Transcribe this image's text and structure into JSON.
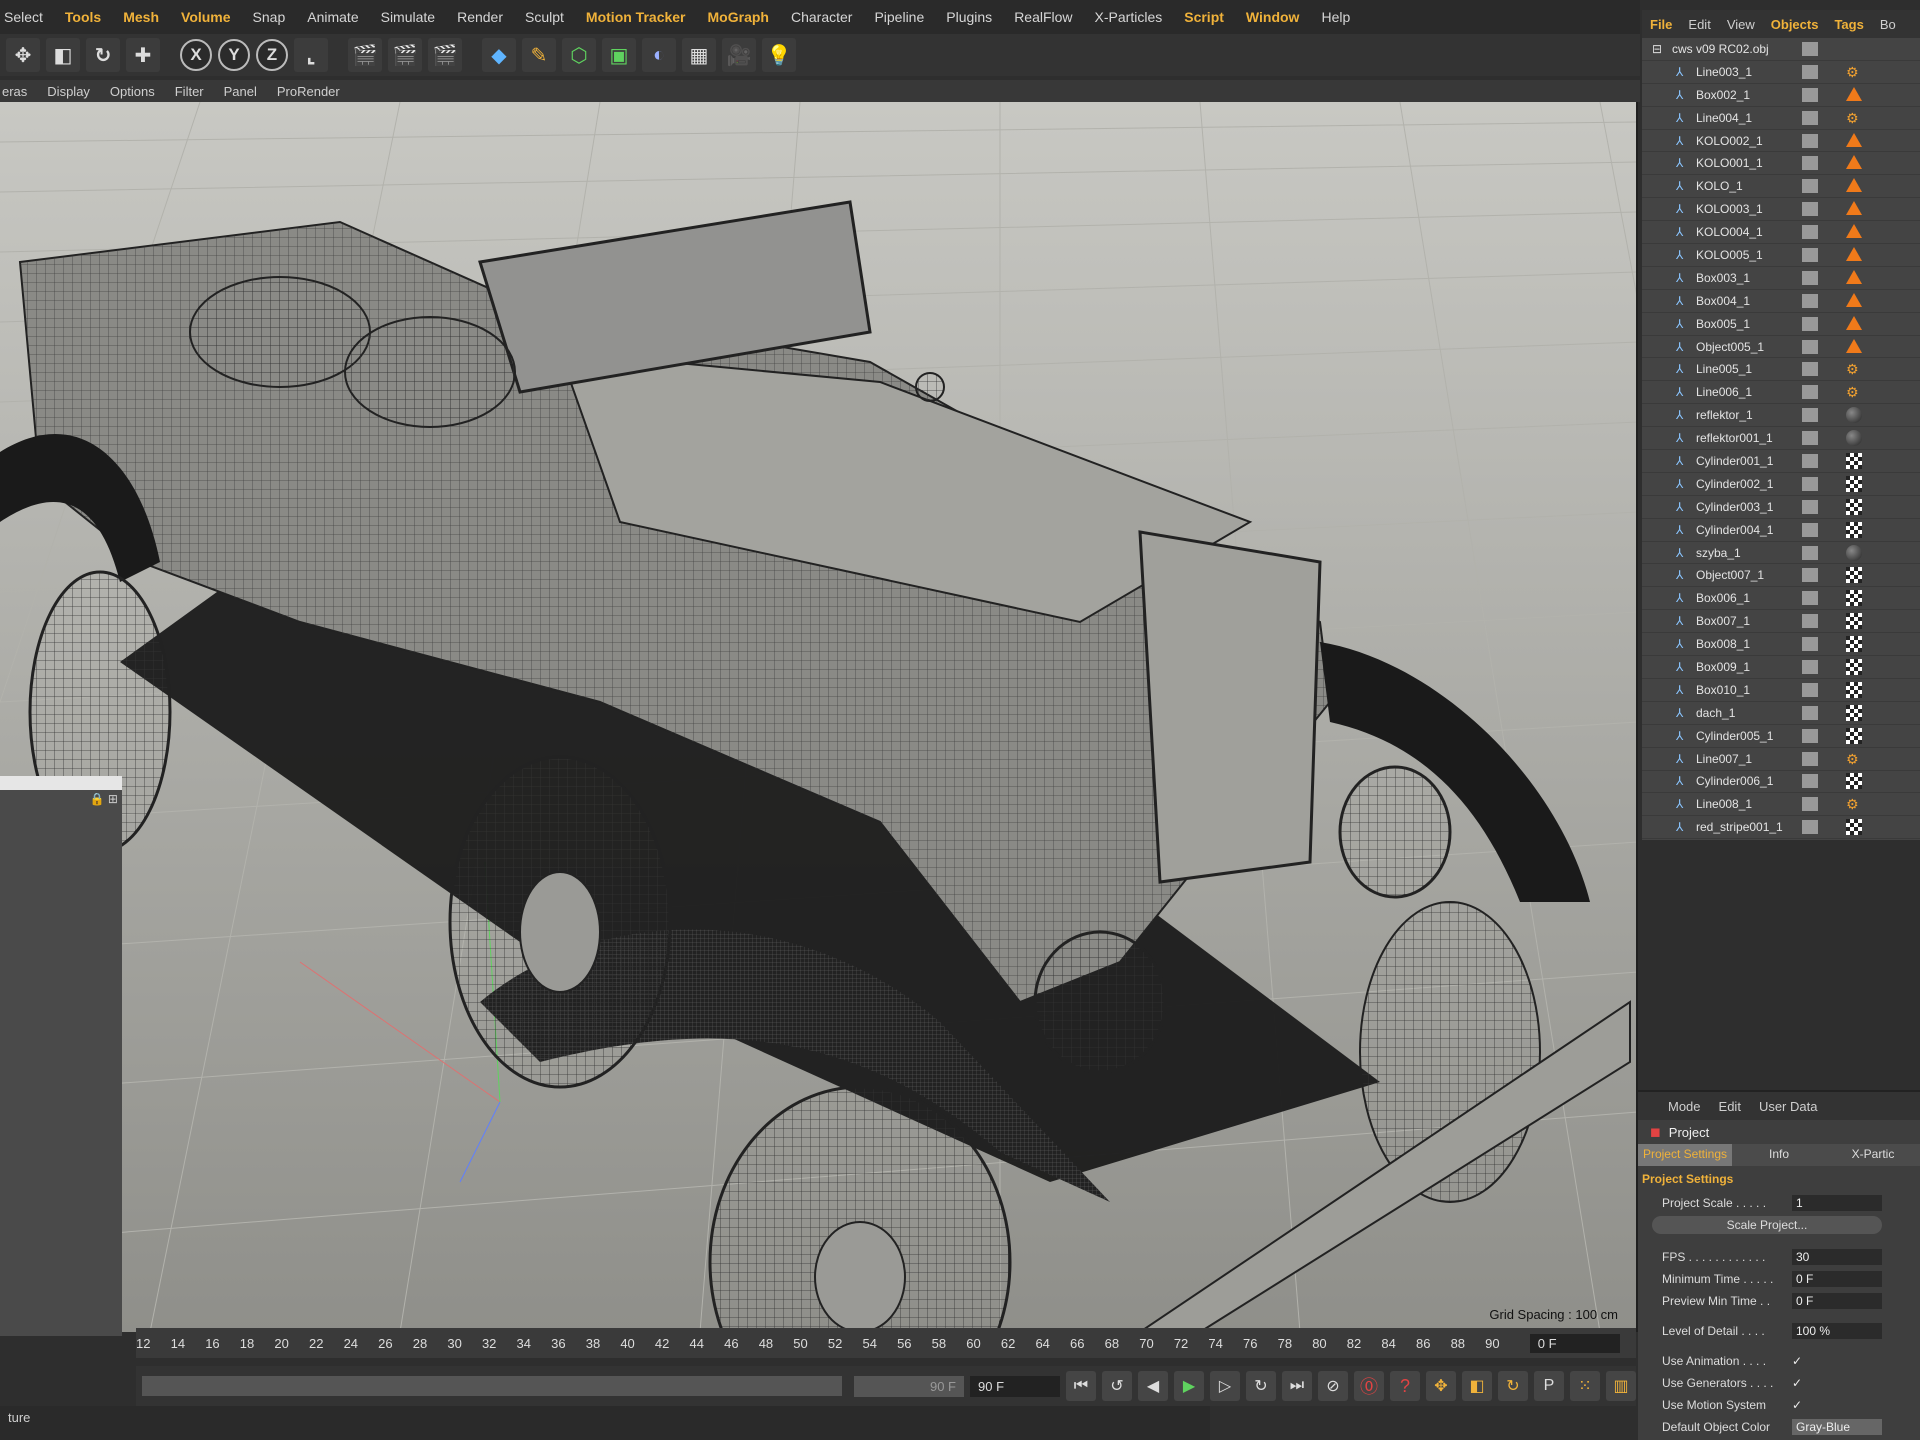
{
  "menubar": [
    "Select",
    "Tools",
    "Mesh",
    "Volume",
    "Snap",
    "Animate",
    "Simulate",
    "Render",
    "Sculpt",
    "Motion Tracker",
    "MoGraph",
    "Character",
    "Pipeline",
    "Plugins",
    "RealFlow",
    "X-Particles",
    "Script",
    "Window",
    "Help"
  ],
  "menubar_highlight": [
    "Tools",
    "Mesh",
    "Volume",
    "Motion Tracker",
    "MoGraph",
    "Script",
    "Window"
  ],
  "toolbar": {
    "axis_x": "X",
    "axis_y": "Y",
    "axis_z": "Z"
  },
  "viewmenu": [
    "eras",
    "Display",
    "Options",
    "Filter",
    "Panel",
    "ProRender"
  ],
  "viewport": {
    "grid_spacing": "Grid Spacing : 100 cm"
  },
  "timeline": {
    "ticks": [
      "12",
      "14",
      "16",
      "18",
      "20",
      "22",
      "24",
      "26",
      "28",
      "30",
      "32",
      "34",
      "36",
      "38",
      "40",
      "42",
      "44",
      "46",
      "48",
      "50",
      "52",
      "54",
      "56",
      "58",
      "60",
      "62",
      "64",
      "66",
      "68",
      "70",
      "72",
      "74",
      "76",
      "78",
      "80",
      "82",
      "84",
      "86",
      "88",
      "90"
    ],
    "current": "0 F"
  },
  "playbar": {
    "end_left": "90 F",
    "end_right": "90 F"
  },
  "bottomleft": {
    "label": "ture"
  },
  "objmgr": {
    "menu": [
      "File",
      "Edit",
      "View",
      "Objects",
      "Tags",
      "Bo"
    ],
    "menu_highlight": [
      "File",
      "Objects",
      "Tags"
    ],
    "root": "cws v09 RC02.obj",
    "objects": [
      {
        "name": "Line003_1",
        "tag": "gear"
      },
      {
        "name": "Box002_1",
        "tag": "tri"
      },
      {
        "name": "Line004_1",
        "tag": "gear"
      },
      {
        "name": "KOLO002_1",
        "tag": "tri"
      },
      {
        "name": "KOLO001_1",
        "tag": "tri"
      },
      {
        "name": "KOLO_1",
        "tag": "tri"
      },
      {
        "name": "KOLO003_1",
        "tag": "tri"
      },
      {
        "name": "KOLO004_1",
        "tag": "tri"
      },
      {
        "name": "KOLO005_1",
        "tag": "tri"
      },
      {
        "name": "Box003_1",
        "tag": "tri"
      },
      {
        "name": "Box004_1",
        "tag": "tri"
      },
      {
        "name": "Box005_1",
        "tag": "tri"
      },
      {
        "name": "Object005_1",
        "tag": "tri"
      },
      {
        "name": "Line005_1",
        "tag": "gear"
      },
      {
        "name": "Line006_1",
        "tag": "gear"
      },
      {
        "name": "reflektor_1",
        "tag": "ball"
      },
      {
        "name": "reflektor001_1",
        "tag": "ball"
      },
      {
        "name": "Cylinder001_1",
        "tag": "check"
      },
      {
        "name": "Cylinder002_1",
        "tag": "check"
      },
      {
        "name": "Cylinder003_1",
        "tag": "check"
      },
      {
        "name": "Cylinder004_1",
        "tag": "check"
      },
      {
        "name": "szyba_1",
        "tag": "ball"
      },
      {
        "name": "Object007_1",
        "tag": "check"
      },
      {
        "name": "Box006_1",
        "tag": "check"
      },
      {
        "name": "Box007_1",
        "tag": "check"
      },
      {
        "name": "Box008_1",
        "tag": "check"
      },
      {
        "name": "Box009_1",
        "tag": "check"
      },
      {
        "name": "Box010_1",
        "tag": "check"
      },
      {
        "name": "dach_1",
        "tag": "check"
      },
      {
        "name": "Cylinder005_1",
        "tag": "check"
      },
      {
        "name": "Line007_1",
        "tag": "gear"
      },
      {
        "name": "Cylinder006_1",
        "tag": "check"
      },
      {
        "name": "Line008_1",
        "tag": "gear"
      },
      {
        "name": "red_stripe001_1",
        "tag": "check"
      }
    ]
  },
  "attrmgr": {
    "menu": [
      "Mode",
      "Edit",
      "User Data"
    ],
    "title": "Project",
    "tabs": [
      "Project Settings",
      "Info",
      "X-Partic"
    ],
    "section": "Project Settings",
    "project_scale_label": "Project Scale . . . . .",
    "project_scale_value": "1",
    "scale_button": "Scale Project...",
    "fps_label": "FPS . . . . . . . . . . . .",
    "fps_value": "30",
    "min_time_label": "Minimum Time . . . . .",
    "min_time_value": "0 F",
    "preview_min_label": "Preview Min Time . .",
    "preview_min_value": "0 F",
    "lod_label": "Level of Detail . . . .",
    "lod_value": "100 %",
    "use_anim_label": "Use Animation . . . .",
    "use_gen_label": "Use Generators . . . .",
    "use_motion_label": "Use Motion System",
    "check": "✓",
    "default_color_label": "Default Object Color",
    "default_color_value": "Gray-Blue"
  }
}
